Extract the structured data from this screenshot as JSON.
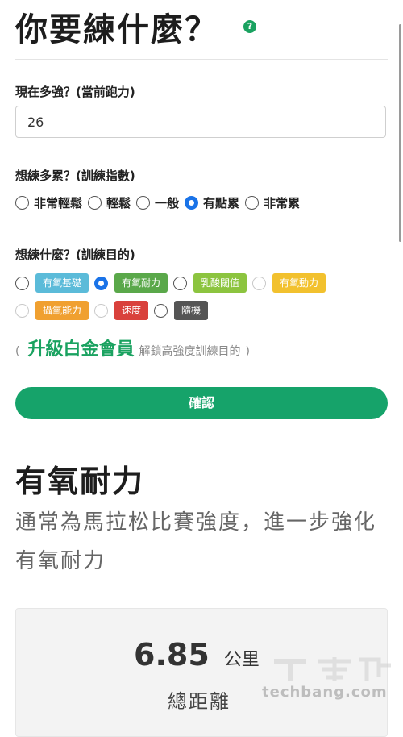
{
  "header": {
    "title": "你要練什麼？",
    "help_icon": "question-circle-icon",
    "help_glyph": "?"
  },
  "current_pace": {
    "label": "現在多強？(當前跑力)",
    "value": "26"
  },
  "intensity": {
    "label": "想練多累？(訓練指數)",
    "options": [
      {
        "label": "非常輕鬆",
        "checked": false
      },
      {
        "label": "輕鬆",
        "checked": false
      },
      {
        "label": "一般",
        "checked": false
      },
      {
        "label": "有點累",
        "checked": true
      },
      {
        "label": "非常累",
        "checked": false
      }
    ]
  },
  "goal": {
    "label": "想練什麼？(訓練目的)",
    "options": [
      {
        "label": "有氧基礎",
        "color": "#5bbbd9",
        "checked": false
      },
      {
        "label": "有氧耐力",
        "color": "#5aa84a",
        "checked": true
      },
      {
        "label": "乳酸閾值",
        "color": "#8cc43f",
        "checked": false
      },
      {
        "label": "有氧動力",
        "color": "#f2c12e",
        "checked": false
      },
      {
        "label": "攝氧能力",
        "color": "#f0a030",
        "checked": false
      },
      {
        "label": "速度",
        "color": "#d9413c",
        "checked": false
      },
      {
        "label": "隨機",
        "color": "#555555",
        "checked": false
      }
    ]
  },
  "upgrade": {
    "open": "(",
    "link": "升級白金會員",
    "text": "解鎖高強度訓練目的",
    "close": ")"
  },
  "confirm_label": "確認",
  "result": {
    "title": "有氧耐力",
    "description": "通常為馬拉松比賽強度，進一步強化有氧耐力",
    "distance_value": "6.85",
    "distance_unit": "公里",
    "distance_label": "總距離"
  },
  "watermark": {
    "text": "techbang.com"
  },
  "colors": {
    "accent": "#16a36a",
    "radio_checked": "#1a73e8"
  }
}
